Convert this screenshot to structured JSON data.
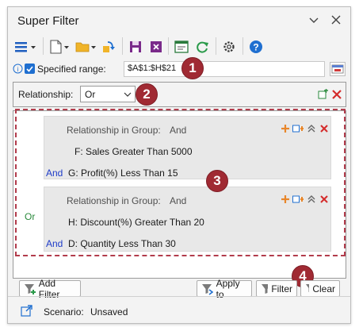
{
  "window": {
    "title": "Super Filter"
  },
  "range": {
    "label": "Specified range:",
    "value": "$A$1:$H$21",
    "checked": true
  },
  "relationship": {
    "label": "Relationship:",
    "value": "Or"
  },
  "outer_relation": "Or",
  "groups": [
    {
      "title": "Relationship in Group:",
      "relation": "And",
      "conditions": [
        {
          "text": "F: Sales  Greater Than  5000"
        },
        {
          "joiner": "And",
          "text": "G: Profit(%)  Less Than  15"
        }
      ]
    },
    {
      "title": "Relationship in Group:",
      "relation": "And",
      "conditions": [
        {
          "text": "H: Discount(%)  Greater Than  20"
        },
        {
          "joiner": "And",
          "text": "D: Quantity  Less Than  30"
        }
      ]
    }
  ],
  "buttons": {
    "add_filter": "Add Filter",
    "apply_to": "Apply to",
    "filter": "Filter",
    "clear": "Clear"
  },
  "status": {
    "label": "Scenario:",
    "value": "Unsaved"
  },
  "badges": [
    "1",
    "2",
    "3",
    "4"
  ],
  "colors": {
    "accent_blue": "#1f6fd0",
    "badge_red": "#a02a33",
    "delete_red": "#d42b2b",
    "add_orange": "#e8862a",
    "dash": "#b23c4c"
  }
}
